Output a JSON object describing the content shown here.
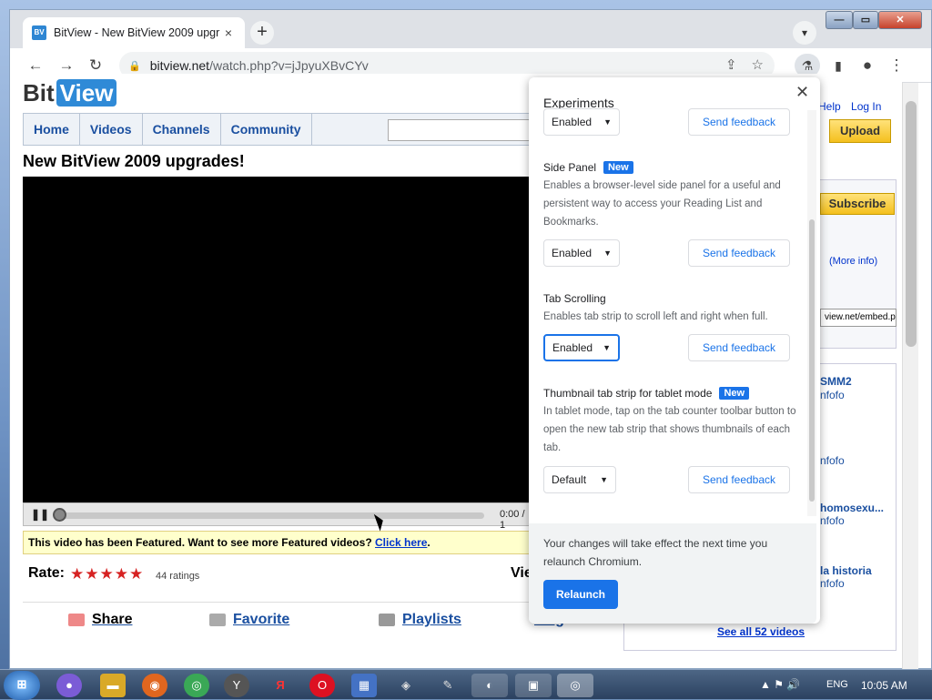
{
  "browser": {
    "tab_title": "BitView - New BitView 2009 upgr",
    "tab_close": "×",
    "new_tab": "+",
    "url_host": "bitview.net",
    "url_path": "/watch.php?v=jJpyuXBvCYv"
  },
  "site": {
    "logo_bit": "Bit",
    "logo_view": "View",
    "top_links": [
      "Help",
      "Log In"
    ],
    "nav": [
      "Home",
      "Videos",
      "Channels",
      "Community"
    ],
    "upload": "Upload",
    "video_title": "New BitView 2009 upgrades!",
    "time": "0:00 / 1",
    "featured_text": "This video has been Featured. Want to see more Featured videos?",
    "featured_link": "Click here",
    "rate_label": "Rate:",
    "ratings": "44 ratings",
    "views_label": "Vie",
    "rating_value": 4.5,
    "actions": [
      "Share",
      "Favorite",
      "Playlists",
      "Flag"
    ],
    "subscribe": "Subscribe",
    "more_info": "(More info)",
    "embed": "view.net/embed.p",
    "related": [
      {
        "title": "SMM2",
        "sub": "nfofo"
      },
      {
        "title": "",
        "sub": "nfofo"
      },
      {
        "title": "homosexu...",
        "sub": "nfofo"
      },
      {
        "title": "la historia",
        "sub": "nfofo"
      }
    ],
    "see_all": "See all 52 videos"
  },
  "experiments": {
    "header": "Experiments",
    "items": [
      {
        "name": "",
        "badge": "",
        "desc": "",
        "value": "Enabled",
        "feedback": "Send feedback"
      },
      {
        "name": "Side Panel",
        "badge": "New",
        "desc": "Enables a browser-level side panel for a useful and persistent way to access your Reading List and Bookmarks.",
        "value": "Enabled",
        "feedback": "Send feedback"
      },
      {
        "name": "Tab Scrolling",
        "badge": "",
        "desc": "Enables tab strip to scroll left and right when full.",
        "value": "Enabled",
        "feedback": "Send feedback"
      },
      {
        "name": "Thumbnail tab strip for tablet mode",
        "badge": "New",
        "desc": "In tablet mode, tap on the tab counter toolbar button to open the new tab strip that shows thumbnails of each tab.",
        "value": "Default",
        "feedback": "Send feedback"
      }
    ],
    "footer": "Your changes will take effect the next time you relaunch Chromium.",
    "relaunch": "Relaunch"
  },
  "taskbar": {
    "lang": "ENG",
    "clock": "10:05 AM"
  }
}
